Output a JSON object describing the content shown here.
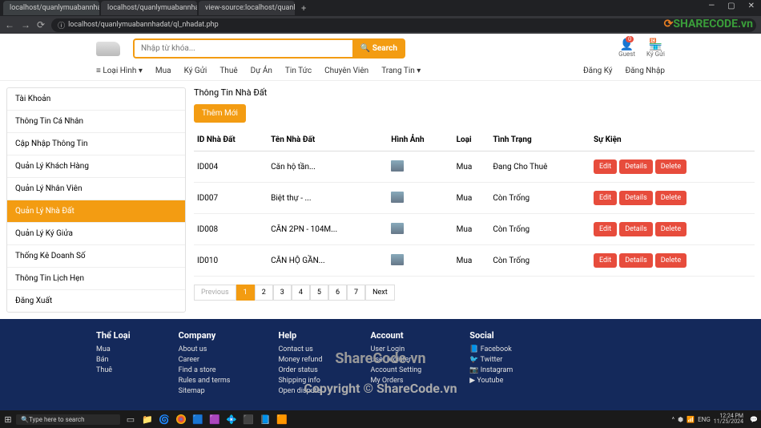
{
  "browser": {
    "tabs": [
      {
        "title": "localhost/quanlymuabannhadat",
        "active": true
      },
      {
        "title": "localhost/quanlymuabannha",
        "active": false
      },
      {
        "title": "view-source:localhost/quanlym",
        "active": false
      }
    ],
    "url": "localhost/quanlymuabannhadat/ql_nhadat.php",
    "window_controls": {
      "min": "—",
      "max": "▢",
      "close": "✕"
    }
  },
  "watermark": {
    "corner": "SHARECODE.vn",
    "center": "ShareCode.vn",
    "copyright": "Copyright © ShareCode.vn"
  },
  "header": {
    "search_placeholder": "Nhập từ khóa...",
    "search_button": "Search",
    "guest": {
      "label": "Guest",
      "badge": "0"
    },
    "kygui": {
      "label": "Ký Gửi"
    }
  },
  "nav": {
    "menu_icon": "≡",
    "items": [
      "Loại Hình ▾",
      "Mua",
      "Ký Gửi",
      "Thuê",
      "Dự Án",
      "Tin Tức",
      "Chuyên Viên",
      "Trang Tin ▾"
    ],
    "right": [
      "Đăng Ký",
      "Đăng Nhập"
    ]
  },
  "sidebar": {
    "items": [
      {
        "label": "Tài Khoản",
        "active": false
      },
      {
        "label": "Thông Tin Cá Nhân",
        "active": false
      },
      {
        "label": "Cập Nhập Thông Tin",
        "active": false
      },
      {
        "label": "Quản Lý Khách Hàng",
        "active": false
      },
      {
        "label": "Quản Lý Nhân Viên",
        "active": false
      },
      {
        "label": "Quản Lý Nhà Đất",
        "active": true
      },
      {
        "label": "Quản Lý Ký Giửa",
        "active": false
      },
      {
        "label": "Thống Kê Doanh Số",
        "active": false
      },
      {
        "label": "Thông Tin Lịch Hẹn",
        "active": false
      },
      {
        "label": "Đăng Xuất",
        "active": false
      }
    ]
  },
  "main": {
    "title": "Thông Tin Nhà Đất",
    "add_button": "Thêm Mới",
    "columns": [
      "ID Nhà Đất",
      "Tên Nhà Đất",
      "Hình Ảnh",
      "Loại",
      "Tình Trạng",
      "Sự Kiện"
    ],
    "action_labels": {
      "edit": "Edit",
      "details": "Details",
      "delete": "Delete"
    },
    "rows": [
      {
        "id": "ID004",
        "name": "Căn hộ tần...",
        "loai": "Mua",
        "status": "Đang Cho Thuê"
      },
      {
        "id": "ID007",
        "name": "Biệt thự - ...",
        "loai": "Mua",
        "status": "Còn Trống"
      },
      {
        "id": "ID008",
        "name": "CĂN 2PN - 104M...",
        "loai": "Mua",
        "status": "Còn Trống"
      },
      {
        "id": "ID010",
        "name": "CĂN HỘ GẦN...",
        "loai": "Mua",
        "status": "Còn Trống"
      }
    ],
    "pagination": {
      "prev": "Previous",
      "pages": [
        "1",
        "2",
        "3",
        "4",
        "5",
        "6",
        "7"
      ],
      "active": 0,
      "next": "Next"
    }
  },
  "footer": {
    "cols": [
      {
        "title": "Thể Loại",
        "links": [
          "Mua",
          "Bán",
          "Thuê"
        ]
      },
      {
        "title": "Company",
        "links": [
          "About us",
          "Career",
          "Find a store",
          "Rules and terms",
          "Sitemap"
        ]
      },
      {
        "title": "Help",
        "links": [
          "Contact us",
          "Money refund",
          "Order status",
          "Shipping info",
          "Open dispute"
        ]
      },
      {
        "title": "Account",
        "links": [
          "User Login",
          "User register",
          "Account Setting",
          "My Orders"
        ]
      },
      {
        "title": "Social",
        "links": [
          "Facebook",
          "Twitter",
          "Instagram",
          "Youtube"
        ],
        "icons": [
          "facebook-icon",
          "twitter-icon",
          "instagram-icon",
          "youtube-icon"
        ]
      }
    ]
  },
  "taskbar": {
    "search_placeholder": "Type here to search",
    "time": "12:24 PM",
    "date": "11/25/2024",
    "lang": "ENG"
  }
}
